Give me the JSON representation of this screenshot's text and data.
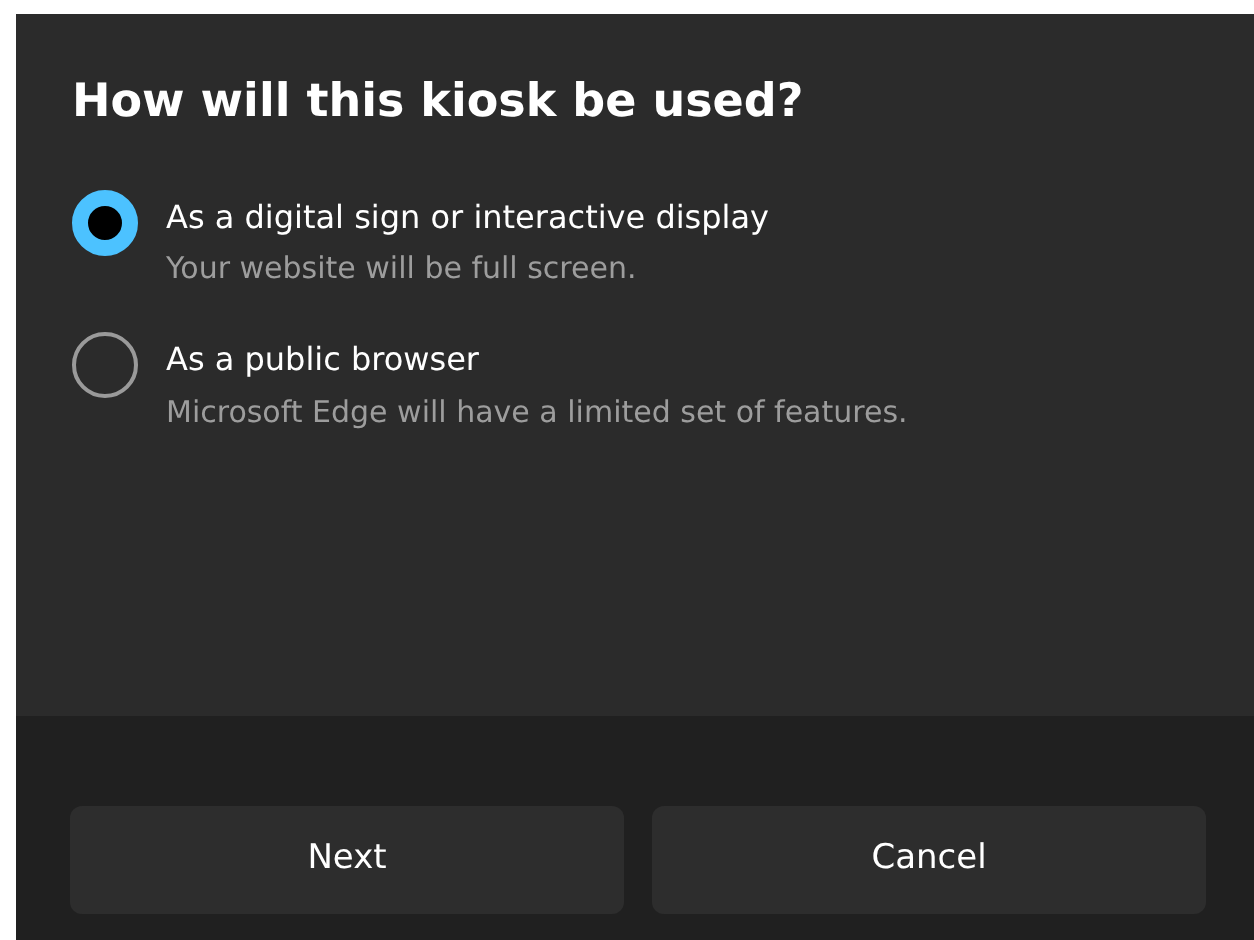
{
  "title": "How will this kiosk be used?",
  "options": [
    {
      "label": "As a digital sign or interactive display",
      "description": "Your website will be full screen.",
      "selected": true
    },
    {
      "label": "As a public browser",
      "description": "Microsoft Edge will have a limited set of features.",
      "selected": false
    }
  ],
  "buttons": [
    "Next",
    "Cancel"
  ]
}
